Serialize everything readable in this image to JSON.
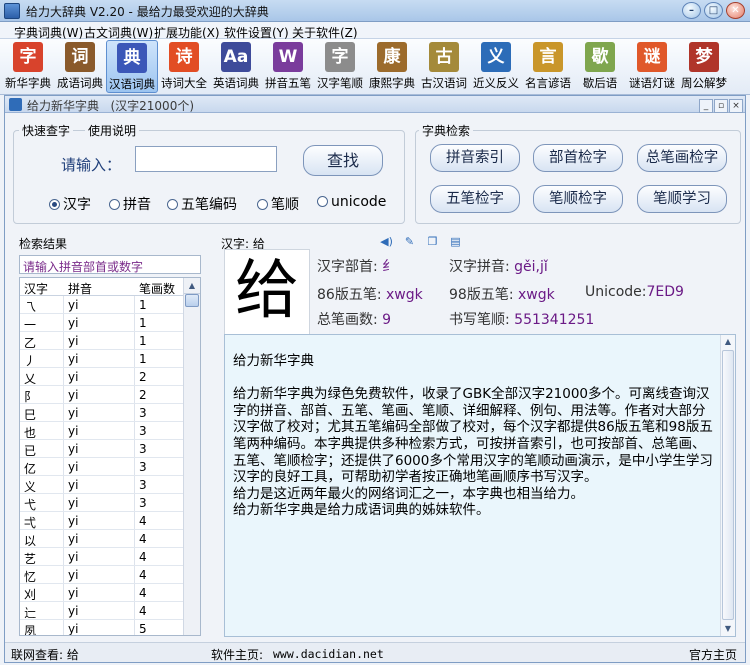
{
  "window": {
    "title": "给力大辞典 V2.20  - 最给力最受欢迎的大辞典"
  },
  "window_controls": {
    "minimize": "–",
    "maximize": "□",
    "close": "✕"
  },
  "menu": [
    "字典词典(W)",
    "古文词典(W)",
    "扩展功能(X)",
    "软件设置(Y)",
    "关于软件(Z)"
  ],
  "toolbar": [
    {
      "label": "新华字典",
      "icon": "xinhua-dict-icon",
      "glyph": "字",
      "color": "#d8432c",
      "active": false
    },
    {
      "label": "成语词典",
      "icon": "idiom-dict-icon",
      "glyph": "词",
      "color": "#8a5a2b",
      "active": false
    },
    {
      "label": "汉语词典",
      "icon": "chinese-dict-icon",
      "glyph": "典",
      "color": "#3b57b8",
      "active": true
    },
    {
      "label": "诗词大全",
      "icon": "poetry-icon",
      "glyph": "诗",
      "color": "#e24d24",
      "active": false
    },
    {
      "label": "英语词典",
      "icon": "english-dict-icon",
      "glyph": "Aa",
      "color": "#3e4b9a",
      "active": false
    },
    {
      "label": "拼音五笔",
      "icon": "pinyin-wubi-icon",
      "glyph": "W",
      "color": "#7a3c9c",
      "active": false
    },
    {
      "label": "汉字笔顺",
      "icon": "stroke-order-icon",
      "glyph": "字",
      "color": "#8c8c8c",
      "active": false
    },
    {
      "label": "康熙字典",
      "icon": "kangxi-dict-icon",
      "glyph": "康",
      "color": "#9c6b2c",
      "active": false
    },
    {
      "label": "古汉语词",
      "icon": "ancient-chinese-icon",
      "glyph": "古",
      "color": "#a48a3a",
      "active": false
    },
    {
      "label": "近义反义",
      "icon": "synonym-icon",
      "glyph": "义",
      "color": "#2c6cb8",
      "active": false
    },
    {
      "label": "名言谚语",
      "icon": "quotes-icon",
      "glyph": "言",
      "color": "#c9962a",
      "active": false
    },
    {
      "label": "歇后语",
      "icon": "xiehouyu-icon",
      "glyph": "歇",
      "color": "#7fa64e",
      "active": false
    },
    {
      "label": "谜语灯谜",
      "icon": "riddle-icon",
      "glyph": "谜",
      "color": "#e0582a",
      "active": false
    },
    {
      "label": "周公解梦",
      "icon": "dream-icon",
      "glyph": "梦",
      "color": "#b0352a",
      "active": false
    }
  ],
  "inner_window": {
    "title": "给力新华字典",
    "subtitle": "(汉字21000个)"
  },
  "quick_lookup": {
    "group_title": "快速查字",
    "help_title": "使用说明",
    "input_label": "请输入：",
    "input_value": "",
    "search_button": "查找",
    "radios": [
      {
        "label": "汉字",
        "checked": true
      },
      {
        "label": "拼音",
        "checked": false
      },
      {
        "label": "五笔编码",
        "checked": false
      },
      {
        "label": "笔顺",
        "checked": false
      },
      {
        "label": "unicode",
        "checked": false
      }
    ]
  },
  "dict_search": {
    "group_title": "字典检索",
    "buttons": [
      "拼音索引",
      "部首检字",
      "总笔画检字",
      "五笔检字",
      "笔顺检字",
      "笔顺学习"
    ]
  },
  "results": {
    "label": "检索结果",
    "hint": "请输入拼音部首或数字",
    "columns": [
      "汉字",
      "拼音",
      "笔画数"
    ],
    "rows": [
      [
        "乁",
        "yi",
        "1"
      ],
      [
        "一",
        "yi",
        "1"
      ],
      [
        "乙",
        "yi",
        "1"
      ],
      [
        "丿",
        "yi",
        "1"
      ],
      [
        "乂",
        "yi",
        "2"
      ],
      [
        "阝",
        "yi",
        "2"
      ],
      [
        "巳",
        "yi",
        "3"
      ],
      [
        "也",
        "yi",
        "3"
      ],
      [
        "已",
        "yi",
        "3"
      ],
      [
        "亿",
        "yi",
        "3"
      ],
      [
        "义",
        "yi",
        "3"
      ],
      [
        "弋",
        "yi",
        "3"
      ],
      [
        "弌",
        "yi",
        "4"
      ],
      [
        "以",
        "yi",
        "4"
      ],
      [
        "艺",
        "yi",
        "4"
      ],
      [
        "忆",
        "yi",
        "4"
      ],
      [
        "刈",
        "yi",
        "4"
      ],
      [
        "辷",
        "yi",
        "4"
      ],
      [
        "夙",
        "yi",
        "5"
      ]
    ]
  },
  "detail": {
    "header": "汉字: 给",
    "character": "给",
    "radical_label": "汉字部首:",
    "radical_value": "纟",
    "pinyin_label": "汉字拼音:",
    "pinyin_value": "gěi,jǐ",
    "wubi86_label": "86版五笔:",
    "wubi86_value": "xwgk",
    "wubi98_label": "98版五笔:",
    "wubi98_value": "xwgk",
    "unicode_label": "Unicode:",
    "unicode_value": "7ED9",
    "strokes_label": "总笔画数:",
    "strokes_value": "9",
    "stroke_order_label": "书写笔顺:",
    "stroke_order_value": "551341251",
    "article_title": "给力新华字典",
    "article_p1": "给力新华字典为绿色免费软件，收录了GBK全部汉字21000多个。可离线查询汉字的拼音、部首、五笔、笔画、笔顺、详细解释、例句、用法等。作者对大部分汉字做了校对；尤其五笔编码全部做了校对，每个汉字都提供86版五笔和98版五笔两种编码。本字典提供多种检索方式，可按拼音索引，也可按部首、总笔画、五笔、笔顺检字；还提供了6000多个常用汉字的笔顺动画演示，是中小学生学习汉字的良好工具，可帮助初学者按正确地笔画顺序书写汉字。",
    "article_p2": "给力是这近两年最火的网络词汇之一，本字典也相当给力。",
    "article_p3": "给力新华字典是给力成语词典的姊妹软件。"
  },
  "statusbar": {
    "left": "联网查看: 给",
    "middle_label": "软件主页:",
    "middle_url": "www.dacidian.net",
    "right": "官方主页"
  }
}
